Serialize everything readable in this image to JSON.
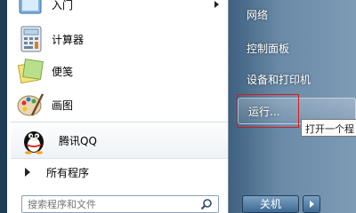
{
  "left_panel": {
    "items": [
      {
        "label": "入门",
        "icon": "getting-started-icon"
      },
      {
        "label": "计算器",
        "icon": "calculator-icon"
      },
      {
        "label": "便笺",
        "icon": "sticky-notes-icon"
      },
      {
        "label": "画图",
        "icon": "paint-palette-icon"
      },
      {
        "label": "腾讯QQ",
        "icon": "qq-penguin-icon"
      }
    ],
    "all_programs": "所有程序",
    "search_placeholder": "搜索程序和文件"
  },
  "right_panel": {
    "items": [
      "网络",
      "控制面板",
      "设备和打印机",
      "运行..."
    ],
    "tooltip": "打开一个程",
    "shutdown_label": "关机"
  }
}
